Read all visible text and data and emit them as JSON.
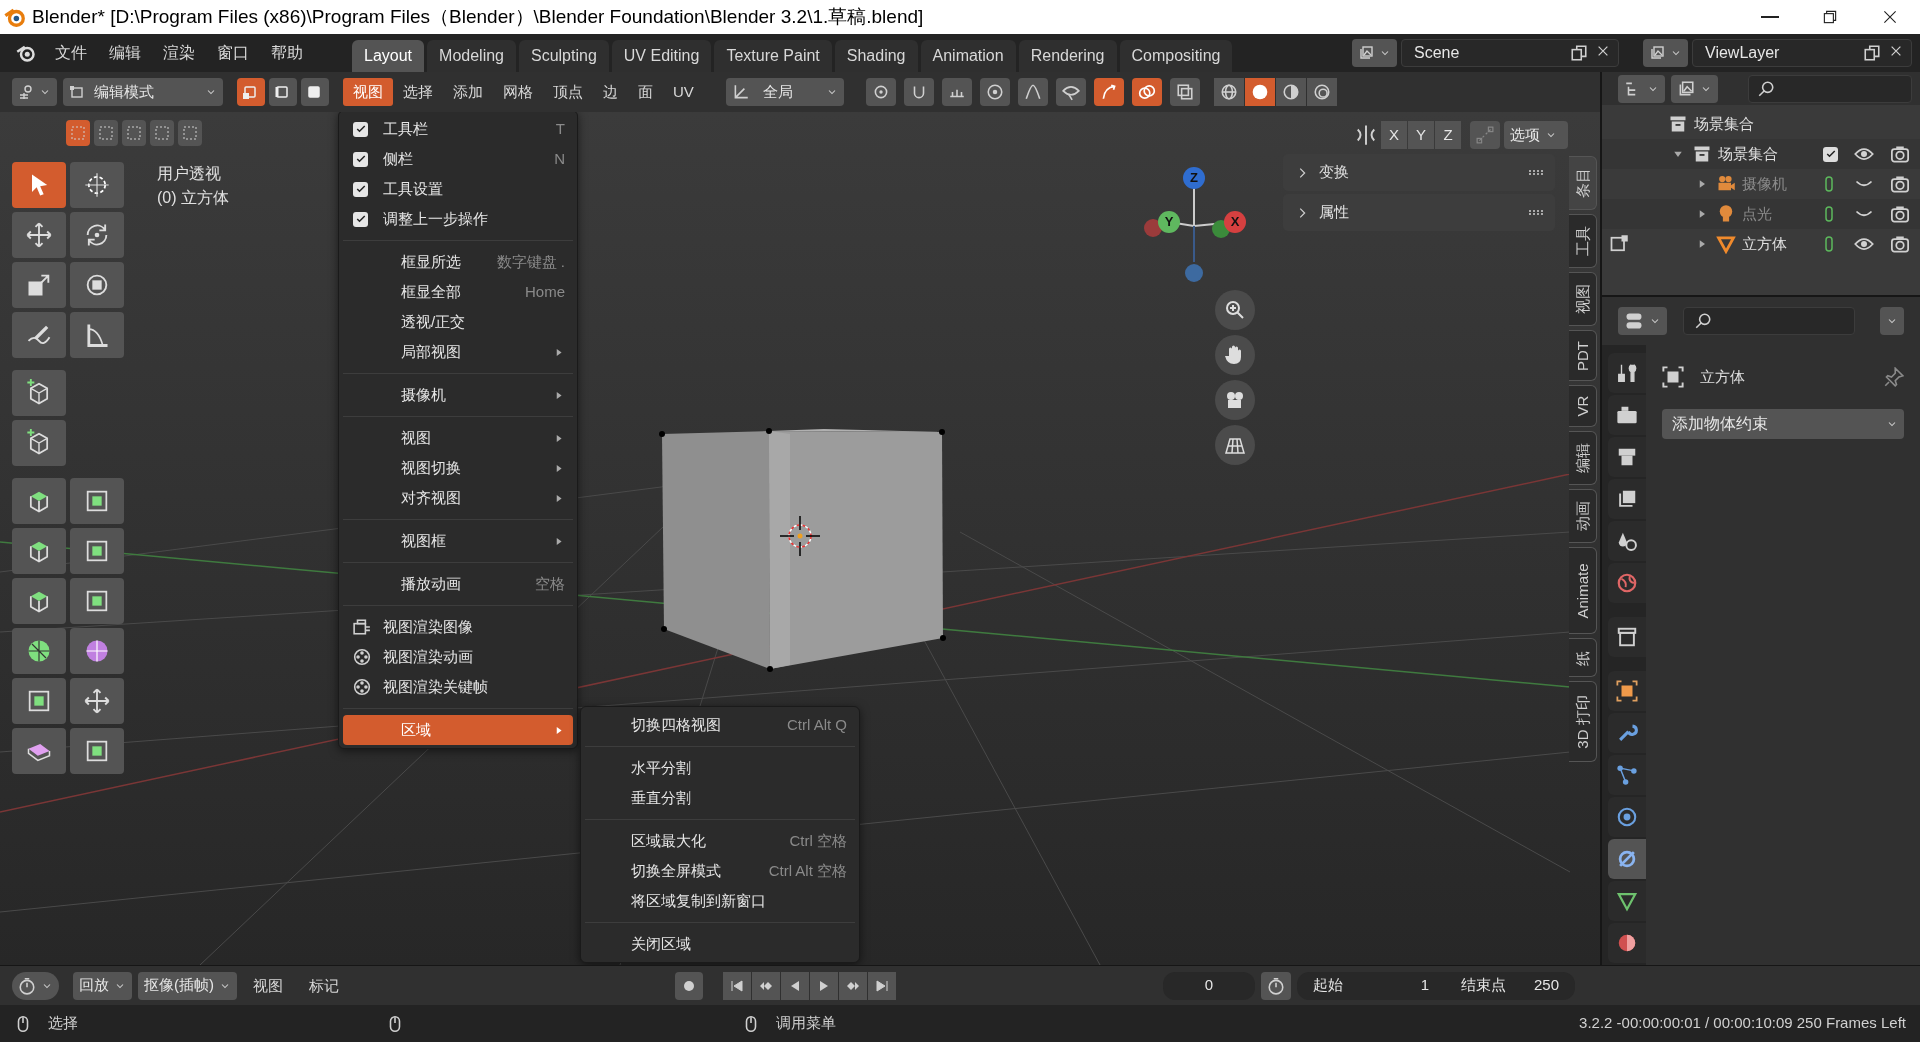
{
  "window": {
    "title": "Blender* [D:\\Program Files (x86)\\Program Files（Blender）\\Blender Foundation\\Blender 3.2\\1.草稿.blend]"
  },
  "menu": [
    "文件",
    "编辑",
    "渲染",
    "窗口",
    "帮助"
  ],
  "workspaces": [
    {
      "label": "Layout",
      "selected": true
    },
    {
      "label": "Modeling",
      "selected": false
    },
    {
      "label": "Sculpting",
      "selected": false
    },
    {
      "label": "UV Editing",
      "selected": false
    },
    {
      "label": "Texture Paint",
      "selected": false
    },
    {
      "label": "Shading",
      "selected": false
    },
    {
      "label": "Animation",
      "selected": false
    },
    {
      "label": "Rendering",
      "selected": false
    },
    {
      "label": "Compositing",
      "selected": false
    }
  ],
  "scene": "Scene",
  "view_layer": "ViewLayer",
  "header": {
    "mode": "编辑模式",
    "orientation": "全局"
  },
  "select_modes": [
    {
      "selected": true
    },
    {
      "selected": false
    },
    {
      "selected": false
    }
  ],
  "header_menus": [
    {
      "label": "视图",
      "selected": true
    },
    {
      "label": "选择",
      "selected": false
    },
    {
      "label": "添加",
      "selected": false
    },
    {
      "label": "网格",
      "selected": false
    },
    {
      "label": "顶点",
      "selected": false
    },
    {
      "label": "边",
      "selected": false
    },
    {
      "label": "面",
      "selected": false
    },
    {
      "label": "UV",
      "selected": false
    }
  ],
  "header_icons": [
    {
      "kind": "pivot",
      "on": false
    },
    {
      "kind": "snap",
      "on": false
    },
    {
      "kind": "increment",
      "on": false
    },
    {
      "kind": "proportional",
      "on": false
    },
    {
      "kind": "falloff",
      "on": false
    },
    {
      "kind": "visibility",
      "on": false
    },
    {
      "kind": "gizmo",
      "on": true
    },
    {
      "kind": "overlay",
      "on": true
    },
    {
      "kind": "xray",
      "on": false
    }
  ],
  "shading": [
    {
      "kind": "wireframe",
      "selected": false
    },
    {
      "kind": "solid",
      "selected": true
    },
    {
      "kind": "material",
      "selected": false
    },
    {
      "kind": "rendered",
      "selected": false
    }
  ],
  "box_modes": [
    {
      "selected": true
    },
    {
      "selected": false
    },
    {
      "selected": false
    },
    {
      "selected": false
    },
    {
      "selected": false
    }
  ],
  "viewport": {
    "view_name": "用户透视",
    "object": "(0) 立方体",
    "axes": [
      "X",
      "Y",
      "Z"
    ],
    "options": "选项",
    "gizmo_axes": [
      "Z",
      "Y",
      "X"
    ]
  },
  "tools": [
    [
      {
        "kind": "select",
        "selected": true
      },
      {
        "kind": "cursor",
        "selected": false
      }
    ],
    [
      {
        "kind": "move",
        "selected": false
      },
      {
        "kind": "rotate",
        "selected": false
      }
    ],
    [
      {
        "kind": "scale",
        "selected": false
      },
      {
        "kind": "transform",
        "selected": false
      }
    ],
    [
      {
        "kind": "annotate",
        "selected": false
      },
      {
        "kind": "measure",
        "selected": false
      }
    ],
    [
      {
        "kind": "add-cube",
        "selected": false
      }
    ],
    [
      {
        "kind": "add-cube",
        "selected": false
      }
    ],
    [
      {
        "kind": "extrude",
        "selected": false
      },
      {
        "kind": "inset",
        "selected": false
      }
    ],
    [
      {
        "kind": "extrude",
        "selected": false
      },
      {
        "kind": "inset",
        "selected": false
      }
    ],
    [
      {
        "kind": "extrude",
        "selected": false
      },
      {
        "kind": "inset",
        "selected": false
      }
    ],
    [
      {
        "kind": "spin",
        "selected": false
      },
      {
        "kind": "smooth",
        "selected": false
      }
    ],
    [
      {
        "kind": "inset",
        "selected": false
      },
      {
        "kind": "move",
        "selected": false
      }
    ],
    [
      {
        "kind": "shear",
        "selected": false
      },
      {
        "kind": "inset",
        "selected": false
      }
    ]
  ],
  "n_panels": [
    "变换",
    "属性"
  ],
  "side_tabs": [
    {
      "label": "条目",
      "selected": true
    },
    {
      "label": "工具",
      "selected": false
    },
    {
      "label": "视图",
      "selected": false
    },
    {
      "label": "PDT",
      "selected": false
    },
    {
      "label": "VR",
      "selected": false
    },
    {
      "label": "编辑",
      "selected": false
    },
    {
      "label": "动画",
      "selected": false
    },
    {
      "label": "Animate",
      "selected": false
    },
    {
      "label": "纸",
      "selected": false
    },
    {
      "label": "3D 打印",
      "selected": false
    }
  ],
  "view_menu": [
    [
      {
        "kind": "check",
        "label": "工具栏",
        "shortcut": "T",
        "checked": true,
        "submenu": false,
        "selected": false
      },
      {
        "kind": "check",
        "label": "侧栏",
        "shortcut": "N",
        "checked": true,
        "submenu": false,
        "selected": false
      },
      {
        "kind": "check",
        "label": "工具设置",
        "checked": true,
        "submenu": false,
        "selected": false
      },
      {
        "kind": "check",
        "label": "调整上一步操作",
        "checked": true,
        "submenu": false,
        "selected": false
      }
    ],
    [
      {
        "kind": "plain",
        "label": "框显所选",
        "shortcut": "数字键盘 .",
        "submenu": false,
        "selected": false
      },
      {
        "kind": "plain",
        "label": "框显全部",
        "shortcut": "Home",
        "submenu": false,
        "selected": false
      },
      {
        "kind": "plain",
        "label": "透视/正交",
        "submenu": false,
        "selected": false
      },
      {
        "kind": "plain",
        "label": "局部视图",
        "submenu": true,
        "selected": false
      }
    ],
    [
      {
        "kind": "plain",
        "label": "摄像机",
        "submenu": true,
        "selected": false
      }
    ],
    [
      {
        "kind": "plain",
        "label": "视图",
        "submenu": true,
        "selected": false
      },
      {
        "kind": "plain",
        "label": "视图切换",
        "submenu": true,
        "selected": false
      },
      {
        "kind": "plain",
        "label": "对齐视图",
        "submenu": true,
        "selected": false
      }
    ],
    [
      {
        "kind": "plain",
        "label": "视图框",
        "submenu": true,
        "selected": false
      }
    ],
    [
      {
        "kind": "plain",
        "label": "播放动画",
        "shortcut": "空格",
        "submenu": false,
        "selected": false
      }
    ],
    [
      {
        "kind": "render-image",
        "label": "视图渲染图像",
        "submenu": false,
        "selected": false
      },
      {
        "kind": "render-animation",
        "label": "视图渲染动画",
        "submenu": false,
        "selected": false
      },
      {
        "kind": "render-animation",
        "label": "视图渲染关键帧",
        "submenu": false,
        "selected": false
      }
    ],
    [
      {
        "kind": "plain",
        "label": "区域",
        "submenu": true,
        "selected": true
      }
    ]
  ],
  "area_menu": [
    [
      {
        "label": "切换四格视图",
        "shortcut": "Ctrl Alt Q"
      }
    ],
    [
      {
        "label": "水平分割"
      },
      {
        "label": "垂直分割"
      }
    ],
    [
      {
        "label": "区域最大化",
        "shortcut": "Ctrl 空格"
      },
      {
        "label": "切换全屏模式",
        "shortcut": "Ctrl Alt 空格"
      },
      {
        "label": "将区域复制到新窗口"
      }
    ],
    [
      {
        "label": "关闭区域"
      }
    ]
  ],
  "outliner": [
    {
      "kind": "scene-collection",
      "label": "场景集合",
      "children": [
        {
          "kind": "collection",
          "label": "场景集合",
          "expanded": true,
          "checked": true,
          "visible": true,
          "children": [
            {
              "kind": "camera",
              "label": "摄像机",
              "expanded": false,
              "visible": false,
              "in_edit_mode": false
            },
            {
              "kind": "light",
              "label": "点光",
              "expanded": false,
              "visible": false,
              "in_edit_mode": false
            },
            {
              "kind": "mesh",
              "label": "立方体",
              "expanded": false,
              "visible": true,
              "in_edit_mode": true
            }
          ]
        }
      ]
    }
  ],
  "property_tabs": [
    {
      "kind": "tool",
      "selected": false
    },
    {
      "kind": "render",
      "selected": false
    },
    {
      "kind": "output",
      "selected": false
    },
    {
      "kind": "view-layer",
      "selected": false
    },
    {
      "kind": "scene",
      "selected": false
    },
    {
      "kind": "world",
      "selected": false
    },
    {
      "kind": "collection",
      "selected": false
    },
    {
      "kind": "object",
      "selected": false
    },
    {
      "kind": "modifier",
      "selected": false
    },
    {
      "kind": "particles",
      "selected": false
    },
    {
      "kind": "physics",
      "selected": false
    },
    {
      "kind": "constraints",
      "selected": true
    },
    {
      "kind": "data",
      "selected": false
    },
    {
      "kind": "material",
      "selected": false
    }
  ],
  "properties": {
    "object_name": "立方体",
    "add_constraint": "添加物体约束"
  },
  "timeline": {
    "playback": "回放",
    "keying": "抠像(插帧)",
    "menus": [
      "视图",
      "标记"
    ],
    "current_frame": "0",
    "start_label": "起始",
    "start": "1",
    "end_label": "结束点",
    "end": "250"
  },
  "status_bar": {
    "left_action": "选择",
    "right_action": "调用菜单",
    "info": "3.2.2 -00:00:00:01 / 00:00:10:09 250 Frames Left"
  }
}
